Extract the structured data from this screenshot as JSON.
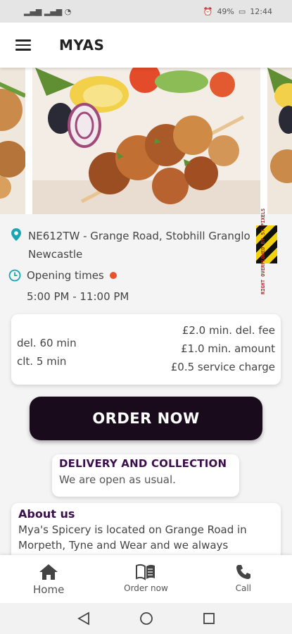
{
  "status_bar": {
    "network": "▂▄▆ ▂▄▆ ◔",
    "battery": "49%",
    "time": "12:44"
  },
  "app_bar": {
    "title": "MYAS",
    "menu_icon": "hamburger-menu-icon"
  },
  "carousel": {
    "slides": [
      {
        "subject": "chicken-skewers-side"
      },
      {
        "subject": "chicken-skewers-main"
      },
      {
        "subject": "chicken-skewers-side"
      }
    ]
  },
  "location": {
    "address_line1": "NE612TW - Grange Road, Stobhill Grang",
    "address_line1_tail": "lo",
    "address_line2": "Newcastle",
    "hours_label": "Opening times",
    "hours_value": "5:00 PM - 11:00 PM",
    "status_color": "#e8542a",
    "overflow_warning": "RIGHT OVERFLOWED BY 57 PIXELS"
  },
  "fees": {
    "delivery_time": "del. 60 min",
    "collection_time": "clt. 5 min",
    "min_delivery_fee": "£2.0 min. del. fee",
    "min_amount": "£1.0 min. amount",
    "service_charge": "£0.5 service charge"
  },
  "order_button": {
    "label": "ORDER NOW"
  },
  "notice": {
    "title": "DELIVERY AND COLLECTION",
    "text": "We are open as usual."
  },
  "about": {
    "title": "About us",
    "text": "Mya's Spicery is located on Grange Road in Morpeth, Tyne and Wear and we always"
  },
  "bottom_nav": {
    "items": [
      {
        "label": "Home",
        "icon": "home-icon"
      },
      {
        "label": "Order now",
        "icon": "menu-book-icon"
      },
      {
        "label": "Call",
        "icon": "phone-icon"
      }
    ]
  },
  "colors": {
    "brand_dark": "#1a0b1c",
    "accent_purple": "#3a0f4c",
    "pin_teal": "#1aa5b3"
  }
}
